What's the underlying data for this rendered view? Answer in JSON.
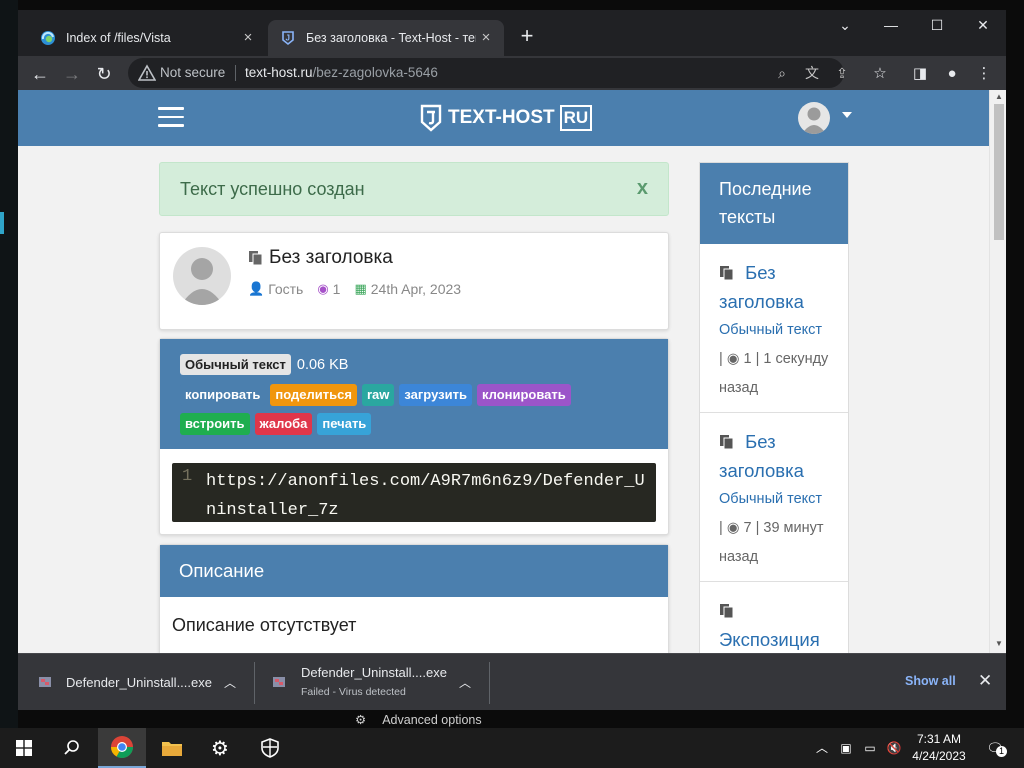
{
  "browser": {
    "tabs": [
      {
        "title": "Index of /files/Vista",
        "active": false
      },
      {
        "title": "Без заголовка - Text-Host - текс",
        "active": true
      }
    ],
    "security_label": "Not secure",
    "url_host": "text-host.ru",
    "url_path": "/bez-zagolovka-5646"
  },
  "site": {
    "logo_text": "TEXT-HOST",
    "logo_badge": "RU",
    "accent_color": "#4b7fae"
  },
  "alert": {
    "text": "Текст успешно создан",
    "close": "x"
  },
  "paste": {
    "title": "Без заголовка",
    "author": "Гость",
    "views": "1",
    "date": "24th Apr, 2023",
    "type_badge": "Обычный текст",
    "size": "0.06 KB",
    "actions_row1": [
      {
        "label": "копировать",
        "color": "#4b7fae"
      },
      {
        "label": "поделиться",
        "color": "#f0960e"
      },
      {
        "label": "raw",
        "color": "#2aa7a0"
      },
      {
        "label": "загрузить",
        "color": "#3c86d8"
      },
      {
        "label": "клонировать",
        "color": "#9b55c9"
      }
    ],
    "actions_row2": [
      {
        "label": "встроить",
        "color": "#1fae4f"
      },
      {
        "label": "жалоба",
        "color": "#e0364a"
      },
      {
        "label": "печать",
        "color": "#37a3d8"
      }
    ],
    "line_number": "1",
    "code": "https://anonfiles.com/A9R7m6n6z9/Defender_Uninstaller_7z"
  },
  "description": {
    "heading": "Описание",
    "body": "Описание отсутствует"
  },
  "sidebar": {
    "heading": "Последние тексты",
    "items": [
      {
        "title": "Без заголовка",
        "type": "Обычный текст",
        "sep": "|",
        "views": "1",
        "ago": "| 1 секунду назад"
      },
      {
        "title": "Без заголовка",
        "type": "Обычный текст",
        "sep": "|",
        "views": "7",
        "ago": "| 39 минут назад"
      },
      {
        "title": "Экспозиция",
        "type": "",
        "sep": "",
        "views": "",
        "ago": ""
      }
    ]
  },
  "downloads": {
    "items": [
      {
        "name": "Defender_Uninstall....exe",
        "status": ""
      },
      {
        "name": "Defender_Uninstall....exe",
        "status": "Failed - Virus detected"
      }
    ],
    "show_all": "Show all"
  },
  "desktop": {
    "advanced_options": "Advanced options"
  },
  "taskbar": {
    "time": "7:31 AM",
    "date": "4/24/2023",
    "notification_count": "1"
  }
}
